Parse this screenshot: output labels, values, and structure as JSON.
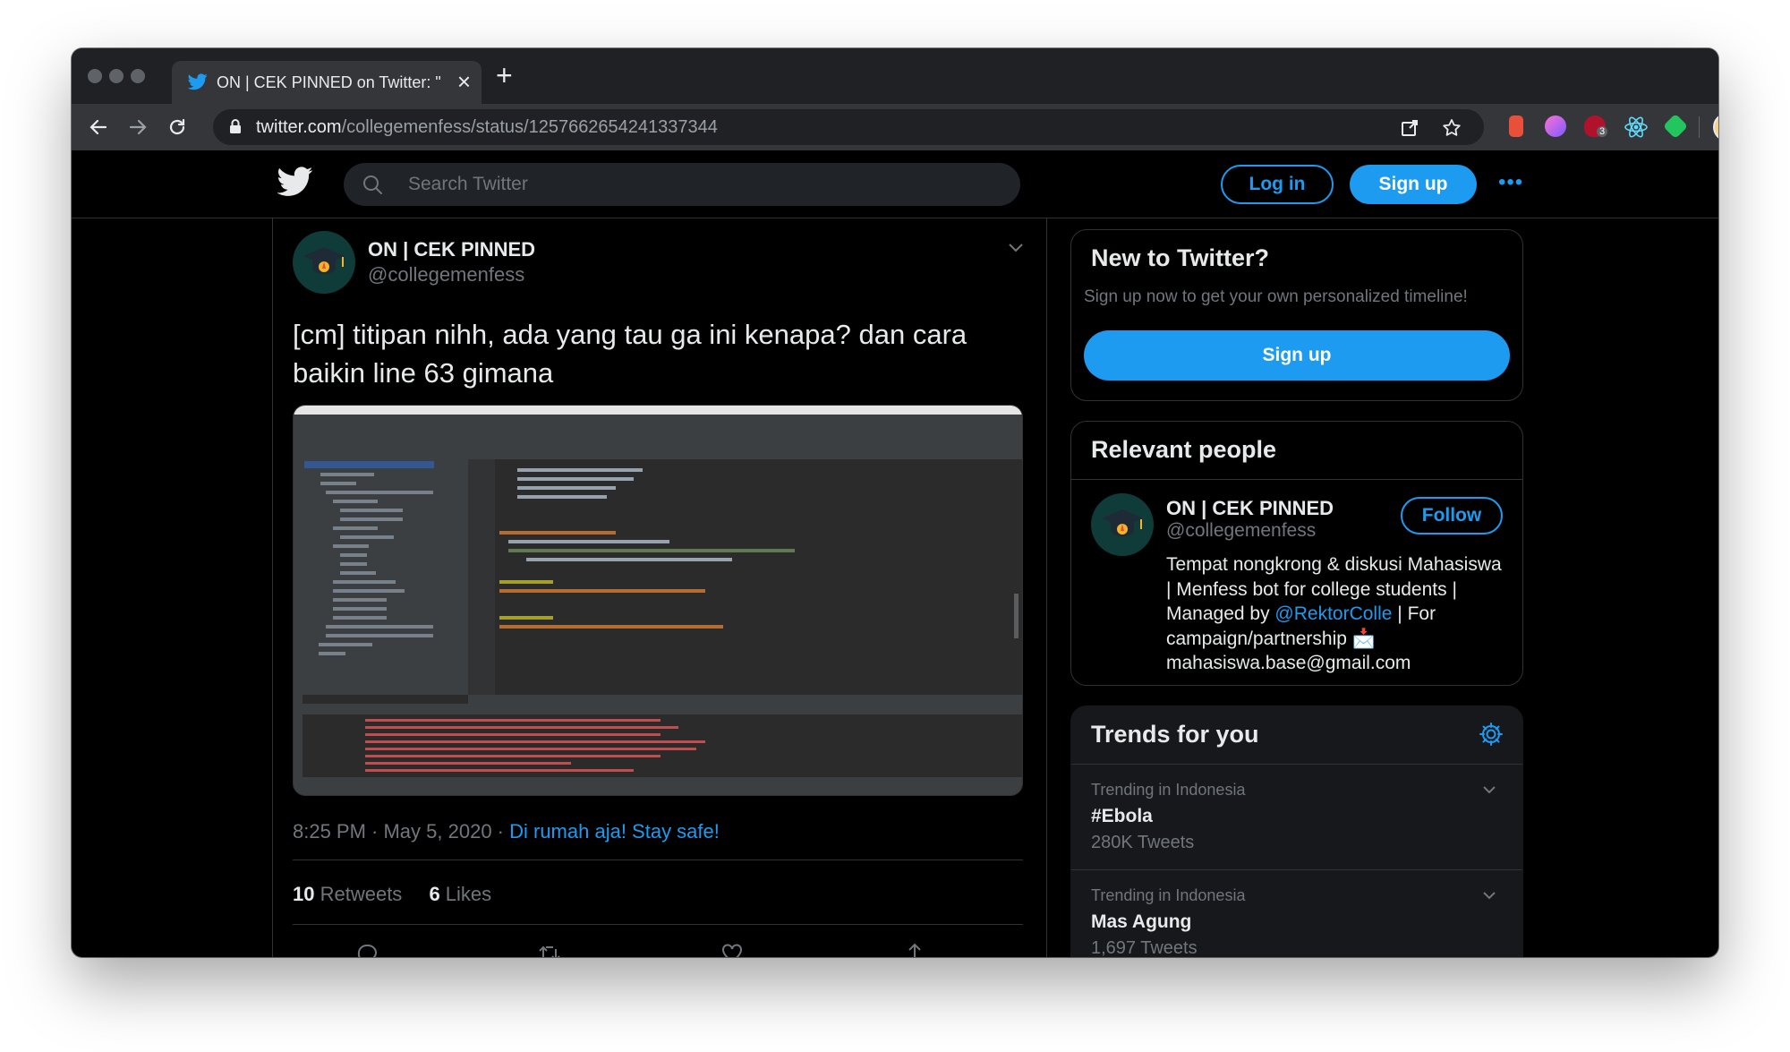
{
  "browser": {
    "tab_title": "ON | CEK PINNED on Twitter: \"",
    "tab_close": "×",
    "new_tab": "+",
    "url_host": "twitter.com",
    "url_path": "/collegemenfess/status/1257662654241337344",
    "extension_badge": "3",
    "colors": {
      "frame": "#202124",
      "toolbar": "#35363a",
      "text": "#e8eaed"
    }
  },
  "header": {
    "search_placeholder": "Search Twitter",
    "login_label": "Log in",
    "signup_label": "Sign up",
    "more_label": "•••"
  },
  "tweet": {
    "display_name": "ON | CEK PINNED",
    "handle": "@collegemenfess",
    "text": "[cm] titipan nihh, ada yang tau ga ini kenapa? dan cara baikin line 63 gimana",
    "time": "8:25 PM · May 5, 2020 · ",
    "source": "Di rumah aja! Stay safe!",
    "retweets_count": "10",
    "retweets_label": " Retweets",
    "likes_count": "6",
    "likes_label": " Likes"
  },
  "sidebar": {
    "new_to_twitter": {
      "title": "New to Twitter?",
      "subtitle": "Sign up now to get your own personalized timeline!",
      "signup_label": "Sign up"
    },
    "relevant_people": {
      "title": "Relevant people",
      "name": "ON | CEK PINNED",
      "handle": "@collegemenfess",
      "follow_label": "Follow",
      "bio_part1": "Tempat nongkrong & diskusi Mahasiswa | Menfess bot for college students | Managed by ",
      "bio_mention": "@RektorColle",
      "bio_part2": " | For campaign/partnership 📩 mahasiswa.base@gmail.com"
    },
    "trends": {
      "title": "Trends for you",
      "items": [
        {
          "context": "Trending in Indonesia",
          "name": "#Ebola",
          "count": "280K Tweets"
        },
        {
          "context": "Trending in Indonesia",
          "name": "Mas Agung",
          "count": "1,697 Tweets"
        }
      ]
    }
  },
  "colors": {
    "accent": "#1d9bf0",
    "background": "#000000",
    "secondary_text": "#71767b"
  }
}
